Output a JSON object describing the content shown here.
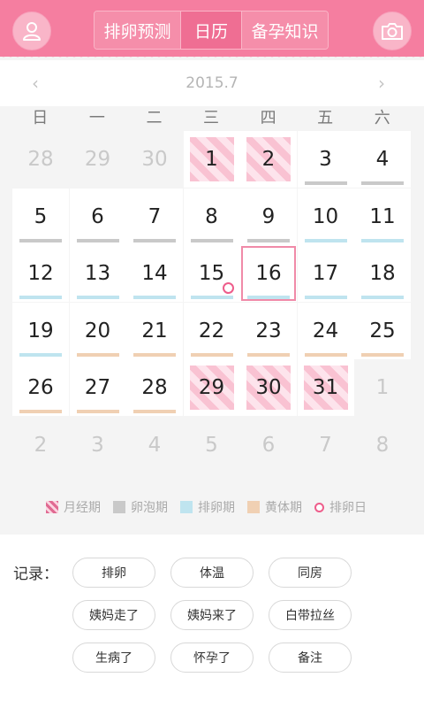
{
  "header": {
    "tabs": [
      {
        "label": "排卵预测",
        "active": false
      },
      {
        "label": "日历",
        "active": true
      },
      {
        "label": "备孕知识",
        "active": false
      }
    ],
    "left_icon": "user-icon",
    "right_icon": "camera-icon",
    "colors": {
      "header_bg": "#f57ea0",
      "accent": "#ee5d8b"
    }
  },
  "month": {
    "label": "2015.7",
    "prev": "‹",
    "next": "›"
  },
  "weekdays": [
    "日",
    "一",
    "二",
    "三",
    "四",
    "五",
    "六"
  ],
  "calendar": {
    "days": [
      {
        "d": "28",
        "cur": false
      },
      {
        "d": "29",
        "cur": false
      },
      {
        "d": "30",
        "cur": false
      },
      {
        "d": "1",
        "cur": true,
        "phase": "menses"
      },
      {
        "d": "2",
        "cur": true,
        "phase": "menses"
      },
      {
        "d": "3",
        "cur": true,
        "phase": "follicle"
      },
      {
        "d": "4",
        "cur": true,
        "phase": "follicle"
      },
      {
        "d": "5",
        "cur": true,
        "phase": "follicle"
      },
      {
        "d": "6",
        "cur": true,
        "phase": "follicle"
      },
      {
        "d": "7",
        "cur": true,
        "phase": "follicle"
      },
      {
        "d": "8",
        "cur": true,
        "phase": "follicle"
      },
      {
        "d": "9",
        "cur": true,
        "phase": "follicle"
      },
      {
        "d": "10",
        "cur": true,
        "phase": "ovulation"
      },
      {
        "d": "11",
        "cur": true,
        "phase": "ovulation"
      },
      {
        "d": "12",
        "cur": true,
        "phase": "ovulation"
      },
      {
        "d": "13",
        "cur": true,
        "phase": "ovulation"
      },
      {
        "d": "14",
        "cur": true,
        "phase": "ovulation"
      },
      {
        "d": "15",
        "cur": true,
        "phase": "ovulation",
        "ovulation_day": true
      },
      {
        "d": "16",
        "cur": true,
        "phase": "ovulation",
        "today": true
      },
      {
        "d": "17",
        "cur": true,
        "phase": "ovulation"
      },
      {
        "d": "18",
        "cur": true,
        "phase": "ovulation"
      },
      {
        "d": "19",
        "cur": true,
        "phase": "ovulation"
      },
      {
        "d": "20",
        "cur": true,
        "phase": "luteal"
      },
      {
        "d": "21",
        "cur": true,
        "phase": "luteal"
      },
      {
        "d": "22",
        "cur": true,
        "phase": "luteal"
      },
      {
        "d": "23",
        "cur": true,
        "phase": "luteal"
      },
      {
        "d": "24",
        "cur": true,
        "phase": "luteal"
      },
      {
        "d": "25",
        "cur": true,
        "phase": "luteal"
      },
      {
        "d": "26",
        "cur": true,
        "phase": "luteal"
      },
      {
        "d": "27",
        "cur": true,
        "phase": "luteal"
      },
      {
        "d": "28",
        "cur": true,
        "phase": "luteal"
      },
      {
        "d": "29",
        "cur": true,
        "phase": "menses"
      },
      {
        "d": "30",
        "cur": true,
        "phase": "menses"
      },
      {
        "d": "31",
        "cur": true,
        "phase": "menses"
      },
      {
        "d": "1",
        "cur": false
      },
      {
        "d": "2",
        "cur": false
      },
      {
        "d": "3",
        "cur": false
      },
      {
        "d": "4",
        "cur": false
      },
      {
        "d": "5",
        "cur": false
      },
      {
        "d": "6",
        "cur": false
      },
      {
        "d": "7",
        "cur": false
      },
      {
        "d": "8",
        "cur": false
      }
    ]
  },
  "legend": [
    {
      "key": "menses",
      "label": "月经期"
    },
    {
      "key": "follicle",
      "label": "卵泡期"
    },
    {
      "key": "ovul",
      "label": "排卵期"
    },
    {
      "key": "luteal",
      "label": "黄体期"
    },
    {
      "key": "day",
      "label": "排卵日"
    }
  ],
  "record": {
    "label": "记录：",
    "chips": [
      "排卵",
      "体温",
      "同房",
      "姨妈走了",
      "姨妈来了",
      "白带拉丝",
      "生病了",
      "怀孕了",
      "备注"
    ]
  }
}
